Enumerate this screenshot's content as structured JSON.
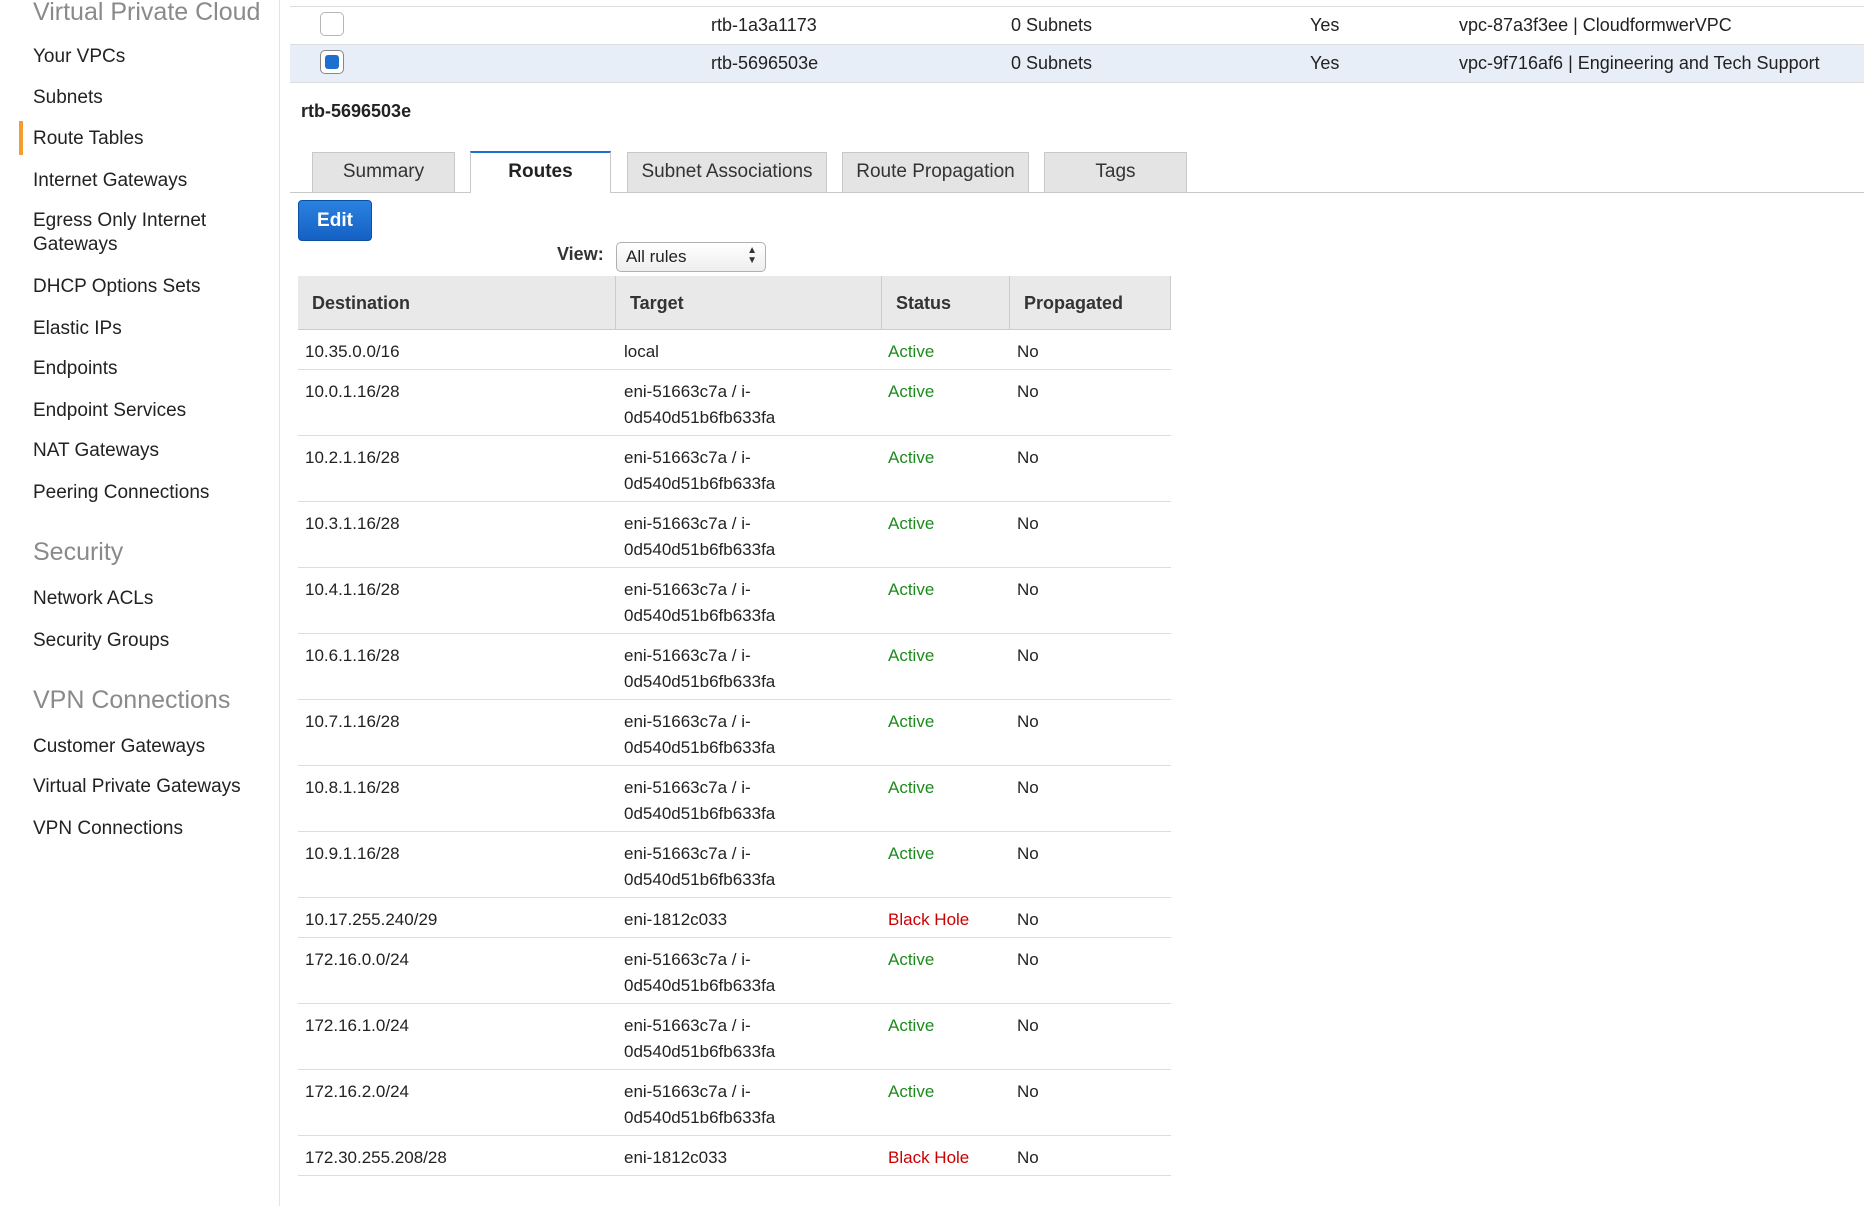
{
  "sidebar": {
    "vpc_section": "Virtual Private Cloud",
    "vpc_items": [
      "Your VPCs",
      "Subnets",
      "Route Tables",
      "Internet Gateways",
      "Egress Only Internet Gateways",
      "DHCP Options Sets",
      "Elastic IPs",
      "Endpoints",
      "Endpoint Services",
      "NAT Gateways",
      "Peering Connections"
    ],
    "active_item": "Route Tables",
    "security_section": "Security",
    "security_items": [
      "Network ACLs",
      "Security Groups"
    ],
    "vpn_section": "VPN Connections",
    "vpn_items": [
      "Customer Gateways",
      "Virtual Private Gateways",
      "VPN Connections"
    ]
  },
  "route_tables": [
    {
      "id": "rtb-1a3a1173",
      "subnets": "0 Subnets",
      "main": "Yes",
      "vpc": "vpc-87a3f3ee | CloudformwerVPC",
      "checked": false
    },
    {
      "id": "rtb-5696503e",
      "subnets": "0 Subnets",
      "main": "Yes",
      "vpc": "vpc-9f716af6 | Engineering and Tech Support",
      "checked": true
    }
  ],
  "detail": {
    "title": "rtb-5696503e",
    "tabs": [
      "Summary",
      "Routes",
      "Subnet Associations",
      "Route Propagation",
      "Tags"
    ],
    "active_tab": "Routes",
    "edit_label": "Edit",
    "view_label": "View:",
    "view_value": "All rules"
  },
  "routes_table": {
    "headers": [
      "Destination",
      "Target",
      "Status",
      "Propagated"
    ],
    "rows": [
      {
        "destination": "10.35.0.0/16",
        "target": [
          "local"
        ],
        "status": "Active",
        "propagated": "No"
      },
      {
        "destination": "10.0.1.16/28",
        "target": [
          "eni-51663c7a / i-",
          "0d540d51b6fb633fa"
        ],
        "status": "Active",
        "propagated": "No"
      },
      {
        "destination": "10.2.1.16/28",
        "target": [
          "eni-51663c7a / i-",
          "0d540d51b6fb633fa"
        ],
        "status": "Active",
        "propagated": "No"
      },
      {
        "destination": "10.3.1.16/28",
        "target": [
          "eni-51663c7a / i-",
          "0d540d51b6fb633fa"
        ],
        "status": "Active",
        "propagated": "No"
      },
      {
        "destination": "10.4.1.16/28",
        "target": [
          "eni-51663c7a / i-",
          "0d540d51b6fb633fa"
        ],
        "status": "Active",
        "propagated": "No"
      },
      {
        "destination": "10.6.1.16/28",
        "target": [
          "eni-51663c7a / i-",
          "0d540d51b6fb633fa"
        ],
        "status": "Active",
        "propagated": "No"
      },
      {
        "destination": "10.7.1.16/28",
        "target": [
          "eni-51663c7a / i-",
          "0d540d51b6fb633fa"
        ],
        "status": "Active",
        "propagated": "No"
      },
      {
        "destination": "10.8.1.16/28",
        "target": [
          "eni-51663c7a / i-",
          "0d540d51b6fb633fa"
        ],
        "status": "Active",
        "propagated": "No"
      },
      {
        "destination": "10.9.1.16/28",
        "target": [
          "eni-51663c7a / i-",
          "0d540d51b6fb633fa"
        ],
        "status": "Active",
        "propagated": "No"
      },
      {
        "destination": "10.17.255.240/29",
        "target": [
          "eni-1812c033"
        ],
        "status": "Black Hole",
        "propagated": "No"
      },
      {
        "destination": "172.16.0.0/24",
        "target": [
          "eni-51663c7a / i-",
          "0d540d51b6fb633fa"
        ],
        "status": "Active",
        "propagated": "No"
      },
      {
        "destination": "172.16.1.0/24",
        "target": [
          "eni-51663c7a / i-",
          "0d540d51b6fb633fa"
        ],
        "status": "Active",
        "propagated": "No"
      },
      {
        "destination": "172.16.2.0/24",
        "target": [
          "eni-51663c7a / i-",
          "0d540d51b6fb633fa"
        ],
        "status": "Active",
        "propagated": "No"
      },
      {
        "destination": "172.30.255.208/28",
        "target": [
          "eni-1812c033"
        ],
        "status": "Black Hole",
        "propagated": "No"
      }
    ]
  },
  "colors": {
    "accent": "#1f6fd1",
    "active_nav": "#f29d2e",
    "status_active": "#1e8a1e",
    "status_blackhole": "#cc0000"
  }
}
